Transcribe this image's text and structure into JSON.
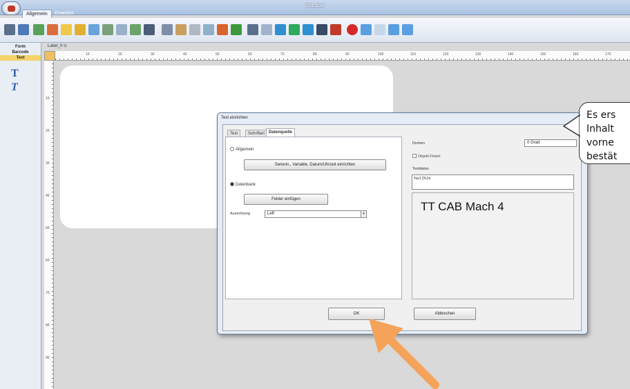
{
  "window": {
    "title": "DoLabel"
  },
  "ribbon": {
    "tabs": [
      "Allgemein",
      "Erweitert"
    ]
  },
  "left_panel": {
    "items": [
      "Form",
      "Barcode",
      "Text"
    ],
    "text_tools": [
      "T",
      "T"
    ]
  },
  "document": {
    "tab_label": "Label_0 ⊙",
    "ruler_h": [
      "10",
      "20",
      "30",
      "40",
      "50",
      "60",
      "70",
      "80",
      "90",
      "100",
      "110",
      "120",
      "130",
      "140",
      "150",
      "160",
      "170"
    ],
    "ruler_v": [
      "10",
      "20",
      "30",
      "40",
      "50",
      "60",
      "70",
      "80",
      "90"
    ]
  },
  "dialog": {
    "title": "Text einrichten",
    "tabs": [
      "Text",
      "Schriftart",
      "Datenquelle"
    ],
    "radio_general": "Allgemein",
    "btn_serial": "Serienn., Variable, Datum/Uhrzeit einrichten",
    "radio_database": "Datenbank",
    "btn_insert_field": "Felder einfügen",
    "alignment_label": "Ausrichtung",
    "alignment_value": "Left",
    "rotate_label": "Drehen",
    "rotate_value": "0 Grad",
    "checkbox_fixed": "Objekt Fixiert",
    "textdata_label": "Textdaten",
    "textdata_value": "%s1 [%1s",
    "preview_text": "TT  CAB Mach 4",
    "ok_label": "OK",
    "cancel_label": "Abbrechen"
  },
  "callout": {
    "lines": [
      "Es ers",
      "Inhalt",
      "vorne",
      "bestät"
    ]
  },
  "colors": {
    "arrow": "#f5a35a",
    "accent": "#2d5aa8"
  }
}
